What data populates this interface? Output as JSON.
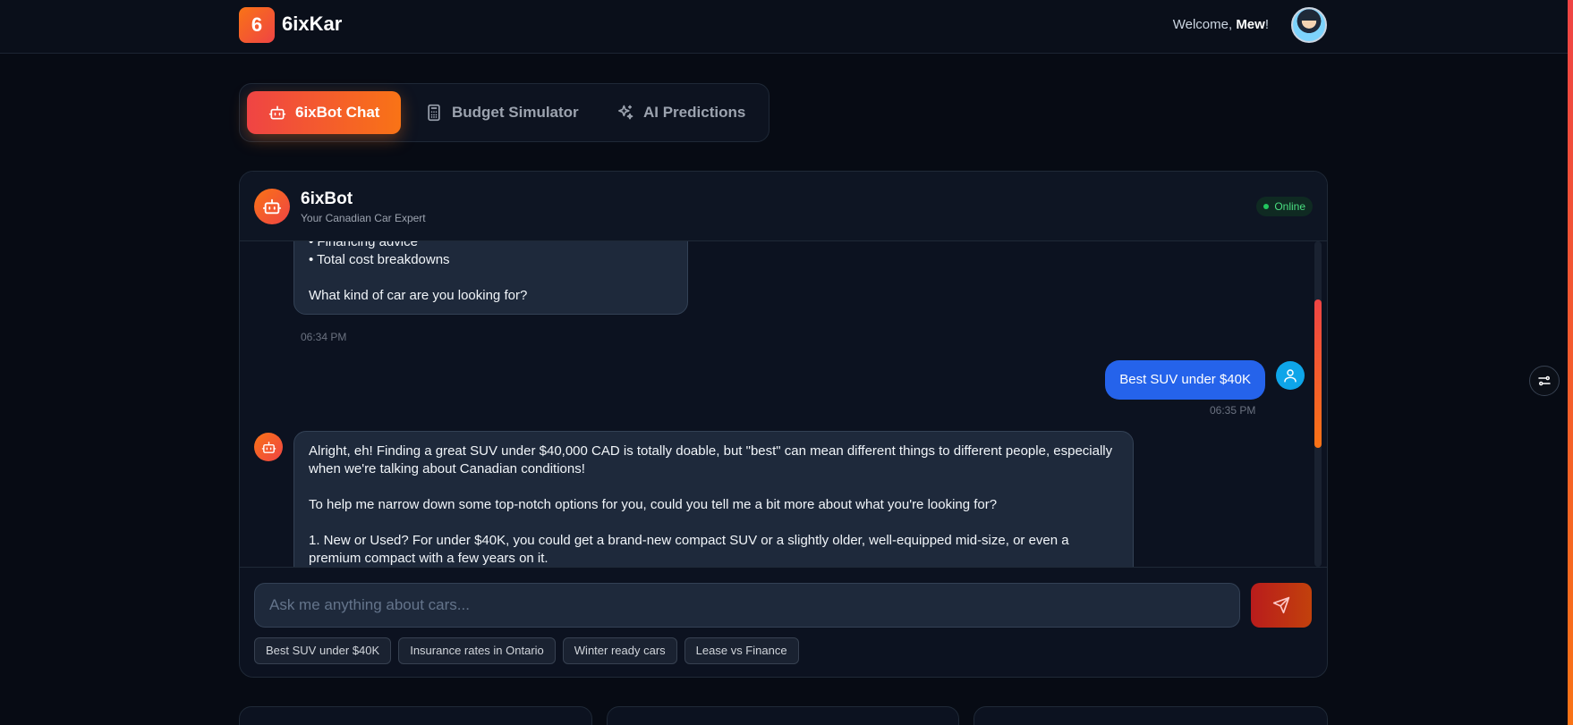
{
  "header": {
    "logo_mark": "6",
    "brand": "6ixKar",
    "welcome_prefix": "Welcome, ",
    "user_name": "Mew",
    "welcome_suffix": "!"
  },
  "tabs": [
    {
      "label": "6ixBot Chat",
      "icon": "robot-icon",
      "active": true
    },
    {
      "label": "Budget Simulator",
      "icon": "calculator-icon",
      "active": false
    },
    {
      "label": "AI Predictions",
      "icon": "sparkles-icon",
      "active": false
    }
  ],
  "chat": {
    "bot_name": "6ixBot",
    "bot_subtitle": "Your Canadian Car Expert",
    "status": "Online",
    "messages": [
      {
        "from": "bot",
        "text": "• Financing advice\n• Total cost breakdowns\n\nWhat kind of car are you looking for?",
        "time": "06:34 PM"
      },
      {
        "from": "user",
        "text": "Best SUV under $40K",
        "time": "06:35 PM"
      },
      {
        "from": "bot",
        "text": "Alright, eh! Finding a great SUV under $40,000 CAD is totally doable, but \"best\" can mean different things to different people, especially when we're talking about Canadian conditions!\n\nTo help me narrow down some top-notch options for you, could you tell me a bit more about what you're looking for?\n\n1.  New or Used? For under $40K, you could get a brand-new compact SUV or a slightly older, well-equipped mid-size, or even a premium compact with a few years on it.",
        "time": ""
      }
    ],
    "input_placeholder": "Ask me anything about cars...",
    "input_value": "",
    "suggestions": [
      "Best SUV under $40K",
      "Insurance rates in Ontario",
      "Winter ready cars",
      "Lease vs Finance"
    ]
  },
  "colors": {
    "accent_start": "#ef4444",
    "accent_end": "#f97316",
    "user_bubble": "#2563eb",
    "online": "#22c55e",
    "background": "#070b14"
  }
}
